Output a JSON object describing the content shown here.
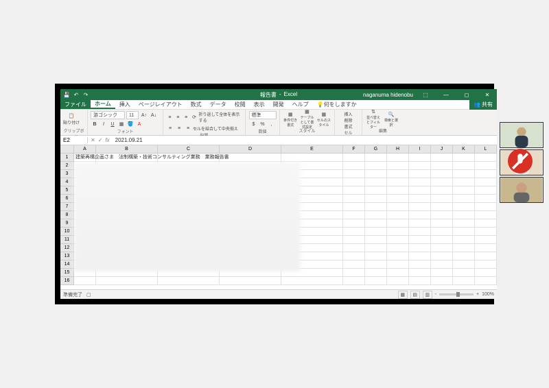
{
  "titlebar": {
    "doc_name": "報告書",
    "app_name": "Excel",
    "username": "naganuma hidenobu"
  },
  "tabs": {
    "file": "ファイル",
    "home": "ホーム",
    "insert": "挿入",
    "page_layout": "ページレイアウト",
    "formulas": "数式",
    "data": "データ",
    "review": "校閲",
    "view": "表示",
    "developer": "開発",
    "help": "ヘルプ",
    "tell_me": "何をしますか"
  },
  "share_button": "共有",
  "ribbon": {
    "clipboard_label": "クリップボード",
    "paste": "貼り付け",
    "font_name": "游ゴシック",
    "font_size": "11",
    "font_label": "フォント",
    "wrap_text": "折り返して全体を表示する",
    "merge_center": "セルを結合して中央揃え",
    "alignment_label": "配置",
    "number_format": "標準",
    "number_label": "数値",
    "cond_format": "条件付き書式",
    "table_format": "テーブルとして書式設定",
    "cell_styles": "セルのスタイル",
    "styles_label": "スタイル",
    "insert": "挿入",
    "delete": "削除",
    "format": "書式",
    "cells_label": "セル",
    "sort_filter": "並べ替えとフィルター",
    "find_select": "検索と選択",
    "editing_label": "編集"
  },
  "formula_bar": {
    "cell_ref": "E2",
    "value": "2021.09.21"
  },
  "columns": [
    "A",
    "B",
    "C",
    "D",
    "E",
    "F",
    "G",
    "H",
    "I",
    "J",
    "K",
    "L"
  ],
  "row1_text": "建築再構企画さま　法制構築・技術コンサルティング業務　業務報告書",
  "statusbar": {
    "ready": "準備完了",
    "zoom": "100%"
  },
  "chart_data": null
}
